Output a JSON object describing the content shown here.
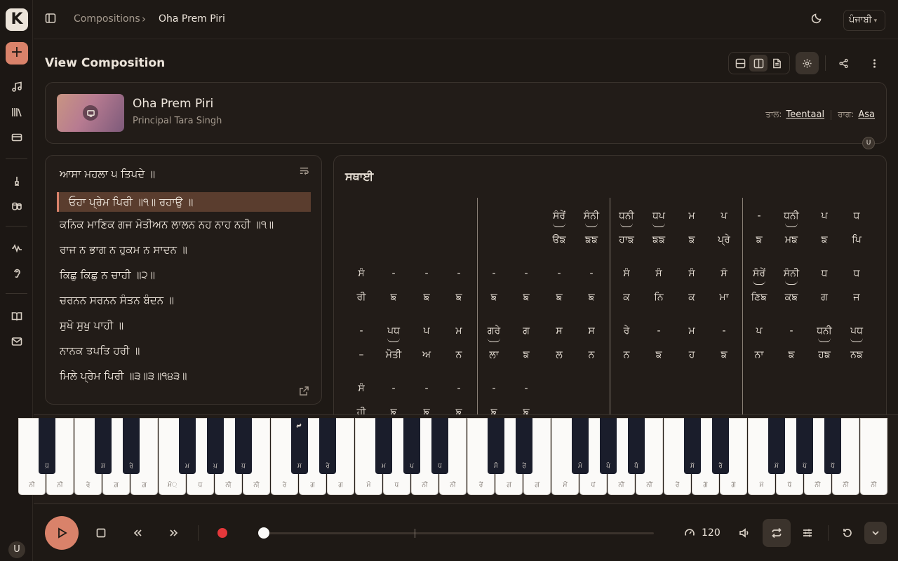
{
  "app": {
    "logo_text": "K",
    "user_initial": "U"
  },
  "breadcrumb": {
    "parent": "Compositions",
    "current": "Oha Prem Piri"
  },
  "language": {
    "selected": "ਪੰਜਾਬੀ"
  },
  "page": {
    "title": "View Composition"
  },
  "composition": {
    "title": "Oha Prem Piri",
    "author": "Principal Tara Singh",
    "taal_label": "ਤਾਲ:",
    "taal": "Teentaal",
    "raag_label": "ਰਾਗ:",
    "raag": "Asa",
    "badge": "U"
  },
  "lyrics": [
    "ਆਸਾ ਮਹਲਾ ੫ ਤਿਪਦੇ ॥",
    "ਓਹਾ ਪ੍ਰੇਮ ਪਿਰੀ ॥੧॥ ਰਹਾਉ ॥",
    "ਕਨਿਕ ਮਾਣਿਕ ਗਜ ਮੋਤੀਅਨ ਲਾਲਨ ਨਹ ਨਾਹ ਨਹੀ ॥੧॥",
    "ਰਾਜ ਨ ਭਾਗ ਨ ਹੁਕਮ ਨ ਸਾਦਨ ॥",
    "ਕਿਛੁ ਕਿਛੁ ਨ ਚਾਹੀ ॥੨॥",
    "ਚਰਨਨ ਸਰਨਨ ਸੰਤਨ ਬੰਦਨ ॥",
    "ਸੁਖੋ ਸੁਖੁ ਪਾਹੀ ॥",
    "ਨਾਨਕ ਤਪਤਿ ਹਰੀ ॥",
    "ਮਿਲੇ ਪ੍ਰੇਮ ਪਿਰੀ ॥੩॥੩॥੧੪੩॥"
  ],
  "lyrics_highlight_index": 1,
  "notation": {
    "section_title": "ਸਥਾਈ",
    "rows": [
      [
        [
          "",
          ""
        ],
        [
          "",
          ""
        ],
        [
          "",
          ""
        ],
        [
          "",
          ""
        ],
        [
          "",
          ""
        ],
        [
          "",
          ""
        ],
        [
          "ਸੰਰੇਂ",
          "ੳਙ",
          "arc"
        ],
        [
          "ਸੰਨੀ",
          "ਙਙ",
          "arc"
        ],
        [
          "ਧਨੀ",
          "ਹਾਙ",
          "arc"
        ],
        [
          "ਧਪ",
          "ਙਙ",
          "arc"
        ],
        [
          "ਮ",
          "ਙ"
        ],
        [
          "ਪ",
          "ਪ੍ਰੇ"
        ],
        [
          "-",
          "ਙ"
        ],
        [
          "ਧਨੀ",
          "ਮਙ",
          "arc"
        ],
        [
          "ਪ",
          "ਙ"
        ],
        [
          "ਧ",
          "ਪਿ"
        ]
      ],
      [
        [
          "ਸੰ",
          "ਰੀ"
        ],
        [
          "-",
          "ਙ"
        ],
        [
          "-",
          "ਙ"
        ],
        [
          "-",
          "ਙ"
        ],
        [
          "-",
          "ਙ"
        ],
        [
          "-",
          "ਙ"
        ],
        [
          "-",
          "ਙ"
        ],
        [
          "-",
          "ਙ"
        ],
        [
          "ਸੰ",
          "ਕ"
        ],
        [
          "ਸੰ",
          "ਨਿ"
        ],
        [
          "ਸੰ",
          "ਕ"
        ],
        [
          "ਸੰ",
          "ਮਾ"
        ],
        [
          "ਸੰਰੇਂ",
          "ਣਿਙ",
          "arc"
        ],
        [
          "ਸੰਨੀ",
          "ਕਙ",
          "arc"
        ],
        [
          "ਧ",
          "ਗ"
        ],
        [
          "ਧ",
          "ਜ"
        ]
      ],
      [
        [
          "-",
          "–"
        ],
        [
          "ਪਧ",
          "ਮੋਤੀ",
          "arc"
        ],
        [
          "ਪ",
          "ਅ"
        ],
        [
          "ਮ",
          "ਨ"
        ],
        [
          "ਗਰੇ",
          "ਲਾ",
          "arc"
        ],
        [
          "ਗ",
          "ਙ"
        ],
        [
          "ਸ",
          "ਲ"
        ],
        [
          "ਸ",
          "ਨ"
        ],
        [
          "ਰੇ",
          "ਨ"
        ],
        [
          "-",
          "ਙ"
        ],
        [
          "ਮ",
          "ਹ"
        ],
        [
          "-",
          "ਙ"
        ],
        [
          "ਪ",
          "ਨਾ"
        ],
        [
          "-",
          "ਙ"
        ],
        [
          "ਧਨੀ",
          "ਹਙ",
          "arc"
        ],
        [
          "ਪਧ",
          "ਨਙ",
          "arc"
        ]
      ],
      [
        [
          "ਸੰ",
          "ਹੀ"
        ],
        [
          "-",
          "ਙ"
        ],
        [
          "-",
          "ਙ"
        ],
        [
          "-",
          "ਙ"
        ],
        [
          "-",
          "ਙ"
        ],
        [
          "-",
          "ਙ"
        ]
      ]
    ]
  },
  "piano": {
    "white_labels": [
      "ਨੀ",
      "ਨ਼ੀ",
      "ਰੇ਼",
      "ਗ਼",
      "ਗ਼",
      "ਮੰ਼",
      "ਧ਼",
      "ਨੀ਼",
      "ਨੀ਼",
      "ਰੇ",
      "ਗ",
      "ਗ",
      "ਮੰ",
      "ਧ",
      "ਨੀ",
      "ਨੀ",
      "ਰੇਂ",
      "ਗਂ",
      "ਗਂ",
      "ਮੰਂ",
      "ਧਂ",
      "ਨੀਂ",
      "ਨੀਂ",
      "ਰੇਂ",
      "ਗੱ",
      "ਗੱ",
      "ਮੱ",
      "ਧੱ",
      "ਨੀੱ",
      "ਨੀੱ",
      "ਨੀੱ"
    ],
    "black_labels": [
      "ਧ਼",
      "ਸ਼",
      "ਰੇ਼",
      "ਮ਼",
      "ਪ਼",
      "ਧ਼",
      "ਸ",
      "ਰੇ",
      "ਮ",
      "ਪ",
      "ਧ",
      "ਸੰ",
      "ਰੇਂ",
      "ਮੰ",
      "ਪੰ",
      "ਧੰ",
      "ਸੱ",
      "ਰੇੱ",
      "ਮੱ",
      "ਪੱ",
      "ਧੱ"
    ]
  },
  "player": {
    "tempo": "120"
  }
}
